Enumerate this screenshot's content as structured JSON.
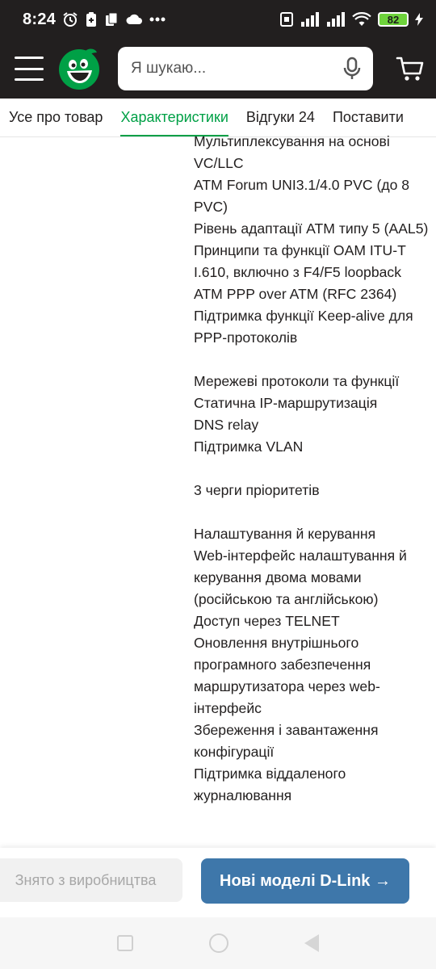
{
  "status_bar": {
    "time": "8:24",
    "battery": "82"
  },
  "header": {
    "search_placeholder": "Я шукаю..."
  },
  "tabs": [
    {
      "label": "Усе про товар"
    },
    {
      "label": "Характеристики"
    },
    {
      "label": "Відгуки 24"
    },
    {
      "label": "Поставити"
    }
  ],
  "spec_lines": [
    "Мультиплексування на основі VC/LLC",
    "ATM Forum UNI3.1/4.0 PVC (до 8 PVC)",
    "Рівень адаптації ATM типу 5 (AAL5)",
    "Принципи та функції OAM ITU-T I.610, включно з F4/F5 loopback",
    "ATM PPP over ATM (RFC 2364)",
    "Підтримка функції Keep-alive для PPP-протоколів",
    "",
    "Мережеві протоколи та функції",
    "Статична IP-маршрутизація",
    "DNS relay",
    "Підтримка VLAN",
    "",
    "3 черги пріоритетів",
    "",
    "Налаштування й керування",
    "Web-інтерфейс налаштування й керування двома мовами (російською та англійською)",
    "Доступ через TELNET",
    "Оновлення внутрішнього програмного забезпечення маршрутизатора через web-інтерфейс",
    "Збереження і завантаження конфігурації",
    "Підтримка віддаленого журналювання"
  ],
  "actions": {
    "discontinued_label": "Знято з виробництва",
    "new_models_label": "Нові моделі D-Link →"
  },
  "colors": {
    "brand_green": "#00a046",
    "header_dark": "#221f1f",
    "action_blue": "#3e77aa"
  }
}
